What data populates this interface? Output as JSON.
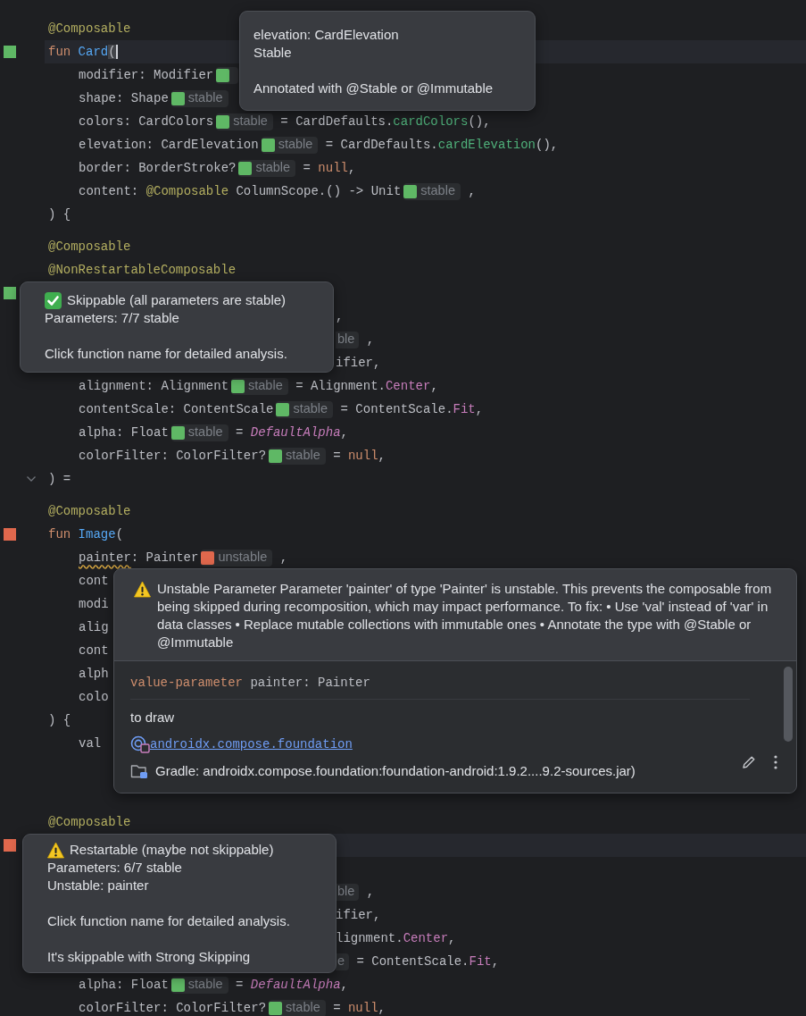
{
  "editor": {
    "blocks": [
      {
        "lines": [
          {
            "kind": "code",
            "current": false,
            "parts": [
              {
                "kind": "annotation",
                "text": "@Composable"
              }
            ]
          },
          {
            "kind": "code",
            "current": true,
            "gutter": {
              "kind": "marker",
              "color": "#5fb865"
            },
            "parts": [
              {
                "kind": "keyword",
                "text": "fun "
              },
              {
                "kind": "function",
                "text": "Card"
              },
              {
                "kind": "brace-match",
                "text": "("
              }
            ]
          },
          {
            "kind": "param",
            "current": false,
            "parts": [
              {
                "kind": "plain",
                "text": "modifier: Modifier"
              },
              {
                "kind": "chip",
                "color": "#5fb865"
              }
            ]
          },
          {
            "kind": "param",
            "current": false,
            "parts": [
              {
                "kind": "plain",
                "text": "shape: Shape"
              },
              {
                "kind": "chip",
                "color": "#5fb865",
                "text": "stable"
              }
            ]
          },
          {
            "kind": "param",
            "current": false,
            "parts": [
              {
                "kind": "plain",
                "text": "colors: CardColors"
              },
              {
                "kind": "chip",
                "color": "#5fb865",
                "text": "stable"
              },
              {
                "kind": "plain",
                "text": " = CardDefaults."
              },
              {
                "kind": "call",
                "text": "cardColors"
              },
              {
                "kind": "plain",
                "text": "(),"
              }
            ]
          },
          {
            "kind": "param",
            "current": false,
            "parts": [
              {
                "kind": "plain",
                "text": "elevation: CardElevation"
              },
              {
                "kind": "chip",
                "color": "#5fb865",
                "text": "stable"
              },
              {
                "kind": "plain",
                "text": " = CardDefaults."
              },
              {
                "kind": "call",
                "text": "cardElevation"
              },
              {
                "kind": "plain",
                "text": "(),"
              }
            ],
            "popup": {
              "kind": "type-info",
              "paragraphs": [
                [
                  "elevation: CardElevation",
                  "Stable"
                ],
                [
                  "Annotated with @Stable or @Immutable"
                ]
              ]
            }
          },
          {
            "kind": "param",
            "current": false,
            "parts": [
              {
                "kind": "plain",
                "text": "border: BorderStroke?"
              },
              {
                "kind": "chip",
                "color": "#5fb865",
                "text": "stable"
              },
              {
                "kind": "plain",
                "text": " = "
              },
              {
                "kind": "null",
                "text": "null"
              },
              {
                "kind": "plain",
                "text": ","
              }
            ]
          },
          {
            "kind": "param",
            "current": false,
            "parts": [
              {
                "kind": "plain",
                "text": "content: "
              },
              {
                "kind": "annotation",
                "text": "@Composable"
              },
              {
                "kind": "plain",
                "text": " ColumnScope.() -> Unit"
              },
              {
                "kind": "chip",
                "color": "#5fb865",
                "text": "stable"
              },
              {
                "kind": "plain",
                "text": " ,"
              }
            ]
          },
          {
            "kind": "code",
            "current": false,
            "parts": [
              {
                "kind": "plain",
                "text": ") {"
              }
            ]
          }
        ]
      },
      {
        "lines": [
          {
            "kind": "code",
            "current": false,
            "parts": [
              {
                "kind": "annotation",
                "text": "@Composable"
              }
            ]
          },
          {
            "kind": "code",
            "current": false,
            "parts": [
              {
                "kind": "annotation",
                "text": "@NonRestartableComposable"
              }
            ]
          },
          {
            "kind": "code",
            "current": false,
            "gutter": {
              "kind": "marker",
              "color": "#5fb865"
            },
            "popup": {
              "kind": "skippable-status",
              "paragraphs": [
                [
                  "Skippable (all parameters are stable)",
                  "Parameters: 7/7 stable"
                ],
                [
                  "Click function name for detailed analysis."
                ]
              ]
            }
          },
          {
            "kind": "partial",
            "current": false,
            "parts": [
              {
                "kind": "plain",
                "text": ","
              }
            ]
          },
          {
            "kind": "partial",
            "current": false,
            "parts": [
              {
                "kind": "chip-tail",
                "text": "ble"
              },
              {
                "kind": "plain",
                "text": " ,"
              }
            ]
          },
          {
            "kind": "partial",
            "current": false,
            "parts": [
              {
                "kind": "plain",
                "text": "ifier,"
              }
            ]
          },
          {
            "kind": "param",
            "current": false,
            "parts": [
              {
                "kind": "plain",
                "text": "alignment: Alignment"
              },
              {
                "kind": "chip",
                "color": "#5fb865",
                "text": "stable"
              },
              {
                "kind": "plain",
                "text": " = Alignment."
              },
              {
                "kind": "constant",
                "text": "Center"
              },
              {
                "kind": "plain",
                "text": ","
              }
            ]
          },
          {
            "kind": "param",
            "current": false,
            "parts": [
              {
                "kind": "plain",
                "text": "contentScale: ContentScale"
              },
              {
                "kind": "chip",
                "color": "#5fb865",
                "text": "stable"
              },
              {
                "kind": "plain",
                "text": " = ContentScale."
              },
              {
                "kind": "constant",
                "text": "Fit"
              },
              {
                "kind": "plain",
                "text": ","
              }
            ]
          },
          {
            "kind": "param",
            "current": false,
            "parts": [
              {
                "kind": "plain",
                "text": "alpha: Float"
              },
              {
                "kind": "chip",
                "color": "#5fb865",
                "text": "stable"
              },
              {
                "kind": "plain",
                "text": " = "
              },
              {
                "kind": "constant-italic",
                "text": "DefaultAlpha"
              },
              {
                "kind": "plain",
                "text": ","
              }
            ]
          },
          {
            "kind": "param",
            "current": false,
            "parts": [
              {
                "kind": "plain",
                "text": "colorFilter: ColorFilter?"
              },
              {
                "kind": "chip",
                "color": "#5fb865",
                "text": "stable"
              },
              {
                "kind": "plain",
                "text": " = "
              },
              {
                "kind": "null",
                "text": "null"
              },
              {
                "kind": "plain",
                "text": ","
              }
            ]
          },
          {
            "kind": "code",
            "current": false,
            "gutter": {
              "kind": "fold"
            },
            "parts": [
              {
                "kind": "plain",
                "text": ") ="
              }
            ]
          }
        ]
      },
      {
        "lines": [
          {
            "kind": "code",
            "current": false,
            "parts": [
              {
                "kind": "annotation",
                "text": "@Composable"
              }
            ]
          },
          {
            "kind": "code",
            "current": false,
            "gutter": {
              "kind": "marker",
              "color": "#e0684d"
            },
            "parts": [
              {
                "kind": "keyword",
                "text": "fun "
              },
              {
                "kind": "function",
                "text": "Image"
              },
              {
                "kind": "plain",
                "text": "("
              }
            ]
          },
          {
            "kind": "param",
            "current": false,
            "parts": [
              {
                "kind": "warned",
                "text": "painter"
              },
              {
                "kind": "plain",
                "text": ": Painter"
              },
              {
                "kind": "chip",
                "color": "#e0684d",
                "text": "unstable"
              },
              {
                "kind": "plain",
                "text": " ,"
              }
            ],
            "popup": {
              "kind": "doc",
              "message": "Unstable Parameter Parameter 'painter' of type 'Painter' is unstable. This prevents the composable from being skipped during recomposition, which may impact performance. To fix: • Use 'val' instead of 'var' in data classes • Replace mutable collections with immutable ones • Annotate the type with @Stable or @Immutable",
              "signature": {
                "keyword": "value-parameter",
                "declaration": "painter: Painter"
              },
              "description": "to draw",
              "package": "androidx.compose.foundation",
              "source": "Gradle: androidx.compose.foundation:foundation-android:1.9.2....9.2-sources.jar)"
            }
          },
          {
            "kind": "param",
            "current": false,
            "parts": [
              {
                "kind": "plain",
                "text": "cont"
              }
            ]
          },
          {
            "kind": "param",
            "current": false,
            "parts": [
              {
                "kind": "plain",
                "text": "modi"
              }
            ]
          },
          {
            "kind": "param",
            "current": false,
            "parts": [
              {
                "kind": "plain",
                "text": "alig"
              }
            ]
          },
          {
            "kind": "param",
            "current": false,
            "parts": [
              {
                "kind": "plain",
                "text": "cont"
              }
            ]
          },
          {
            "kind": "param",
            "current": false,
            "parts": [
              {
                "kind": "plain",
                "text": "alph"
              }
            ]
          },
          {
            "kind": "param",
            "current": false,
            "parts": [
              {
                "kind": "plain",
                "text": "colo"
              }
            ]
          },
          {
            "kind": "code",
            "current": false,
            "parts": [
              {
                "kind": "plain",
                "text": ") {"
              }
            ]
          },
          {
            "kind": "param",
            "current": false,
            "parts": [
              {
                "kind": "plain",
                "text": "val"
              }
            ]
          },
          {
            "kind": "code",
            "current": false
          },
          {
            "kind": "code",
            "current": false
          }
        ]
      },
      {
        "lines": [
          {
            "kind": "code",
            "current": false,
            "parts": [
              {
                "kind": "annotation",
                "text": "@Composable"
              }
            ]
          },
          {
            "kind": "code",
            "current": true,
            "gutter": {
              "kind": "marker",
              "color": "#e0684d"
            },
            "popup": {
              "kind": "restartable-status",
              "paragraphs": [
                [
                  "Restartable (maybe not skippable)",
                  "Parameters: 6/7 stable",
                  "Unstable: painter"
                ],
                [
                  "Click function name for detailed analysis."
                ],
                [
                  "It's skippable with Strong Skipping"
                ]
              ]
            }
          },
          {
            "kind": "code",
            "current": false
          },
          {
            "kind": "partial",
            "current": false,
            "parts": [
              {
                "kind": "chip-tail",
                "text": "ble"
              },
              {
                "kind": "plain",
                "text": " ,"
              }
            ]
          },
          {
            "kind": "partial",
            "current": false,
            "parts": [
              {
                "kind": "plain",
                "text": "ifier,"
              }
            ]
          },
          {
            "kind": "partial",
            "current": false,
            "parts": [
              {
                "kind": "plain",
                "text": "lignment."
              },
              {
                "kind": "constant",
                "text": "Center"
              },
              {
                "kind": "plain",
                "text": ","
              }
            ]
          },
          {
            "kind": "partial",
            "current": false,
            "parts": [
              {
                "kind": "chip-tail",
                "text": "e"
              },
              {
                "kind": "plain",
                "text": " = ContentScale."
              },
              {
                "kind": "constant",
                "text": "Fit"
              },
              {
                "kind": "plain",
                "text": ","
              }
            ]
          },
          {
            "kind": "param",
            "current": false,
            "parts": [
              {
                "kind": "plain",
                "text": "alpha: Float"
              },
              {
                "kind": "chip",
                "color": "#5fb865",
                "text": "stable"
              },
              {
                "kind": "plain",
                "text": " = "
              },
              {
                "kind": "constant-italic",
                "text": "DefaultAlpha"
              },
              {
                "kind": "plain",
                "text": ","
              }
            ]
          },
          {
            "kind": "param",
            "current": false,
            "parts": [
              {
                "kind": "plain",
                "text": "colorFilter: ColorFilter?"
              },
              {
                "kind": "chip",
                "color": "#5fb865",
                "text": "stable"
              },
              {
                "kind": "plain",
                "text": " = "
              },
              {
                "kind": "null",
                "text": "null"
              },
              {
                "kind": "plain",
                "text": ","
              }
            ]
          }
        ]
      }
    ]
  }
}
